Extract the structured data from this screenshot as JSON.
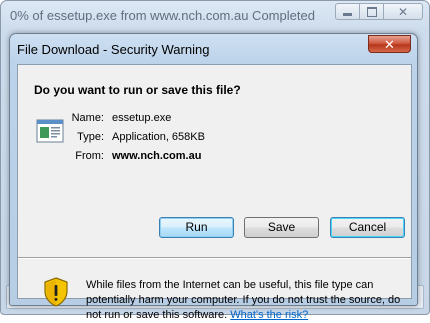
{
  "outer_window": {
    "title": "0% of essetup.exe from www.nch.com.au Completed",
    "minimize_glyph": "",
    "maximize_glyph": "",
    "close_glyph": "✕"
  },
  "dialog": {
    "title": "File Download - Security Warning",
    "close_glyph": "✕",
    "question": "Do you want to run or save this file?",
    "name_label": "Name:",
    "name_value": "essetup.exe",
    "type_label": "Type:",
    "type_value": "Application, 658KB",
    "from_label": "From:",
    "from_value": "www.nch.com.au",
    "buttons": {
      "run": "Run",
      "save": "Save",
      "cancel": "Cancel"
    },
    "warning_text": "While files from the Internet can be useful, this file type can potentially harm your computer. If you do not trust the source, do not run or save this software.",
    "risk_link": "What's the risk?",
    "icons": {
      "file": "application-file-icon",
      "shield": "warning-shield-icon"
    }
  },
  "colors": {
    "shield_yellow": "#f5c400",
    "shield_outline": "#8a6a00",
    "link": "#0066cc",
    "default_button": "#3c7fb1"
  }
}
